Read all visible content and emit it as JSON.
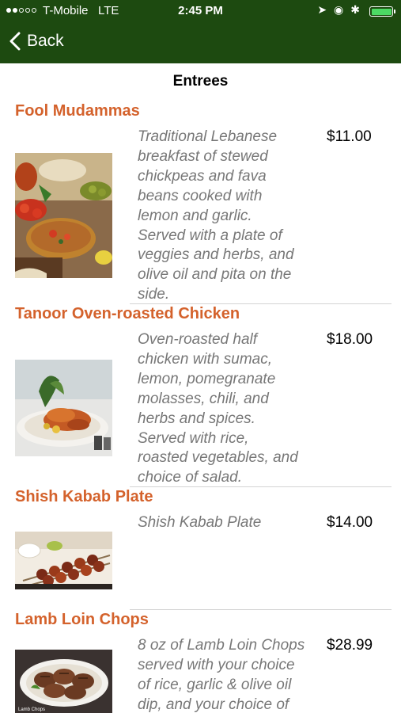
{
  "status_bar": {
    "carrier": "T-Mobile",
    "network": "LTE",
    "time": "2:45 PM",
    "battery_color": "#4cd964"
  },
  "nav": {
    "back_label": "Back",
    "bar_color": "#1d4a10"
  },
  "page": {
    "title": "Entrees"
  },
  "menu": {
    "accent_color": "#d4622c",
    "items": [
      {
        "name": "Fool Mudammas",
        "description_lines": [
          "Traditional Lebanese",
          "breakfast of stewed",
          "chickpeas and fava",
          "beans cooked with",
          "lemon and garlic.",
          "Served with a plate of",
          "veggies and herbs, and",
          "olive oil and pita on the",
          "side."
        ],
        "price": "$11.00"
      },
      {
        "name": "Tanoor Oven-roasted Chicken",
        "description_lines": [
          "Oven-roasted half",
          "chicken with sumac,",
          "lemon, pomegranate",
          "molasses, chili, and",
          "herbs and spices.",
          "Served with rice,",
          "roasted vegetables, and",
          "choice of salad."
        ],
        "price": "$18.00"
      },
      {
        "name": "Shish Kabab Plate",
        "description_lines": [
          "Shish Kabab Plate"
        ],
        "price": "$14.00"
      },
      {
        "name": "Lamb Loin Chops",
        "description_lines": [
          "8 oz of Lamb Loin Chops",
          "served with your choice",
          "of rice, garlic & olive oil",
          "dip, and your choice of"
        ],
        "price": "$28.99",
        "image_caption": "Lamb Chops"
      }
    ]
  }
}
